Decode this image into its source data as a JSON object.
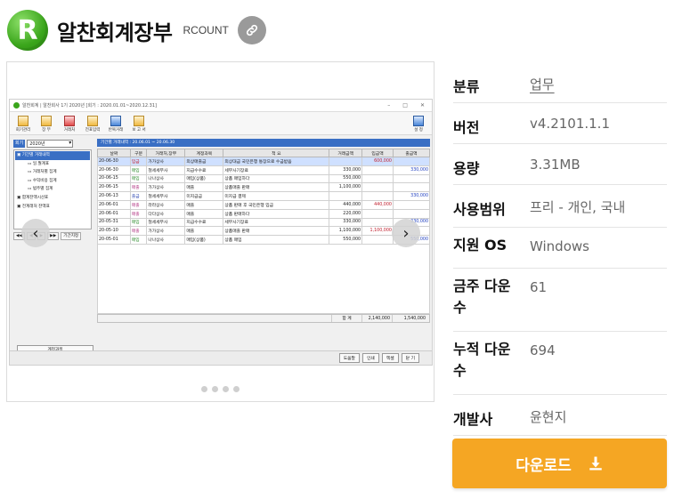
{
  "header": {
    "app_name": "알찬회계장부",
    "app_sub": "RCOUNT",
    "logo_letter": "R"
  },
  "screenshot": {
    "window_title": "알찬회계 | 알찬회사 1기 2020년 [회기 : 2020.01.01~2020.12.31]",
    "toolbar": [
      {
        "label": "회기관리",
        "icon": "folder-icon",
        "color": "gold"
      },
      {
        "label": "장 부",
        "icon": "book-icon",
        "color": "gold"
      },
      {
        "label": "거래처",
        "icon": "contacts-icon",
        "color": "red"
      },
      {
        "label": "전표입력",
        "icon": "voucher-icon",
        "color": "gold"
      },
      {
        "label": "반복거래",
        "icon": "repeat-icon",
        "color": "blue"
      },
      {
        "label": "보 고 서",
        "icon": "report-icon",
        "color": "gold"
      }
    ],
    "toolbar_right": {
      "label": "설 정",
      "icon": "settings-icon"
    },
    "year_label": "회기",
    "year_value": "2020년",
    "tree": [
      {
        "label": "기간별 거래내역",
        "level": "root"
      },
      {
        "label": "일.월계표",
        "level": "sub"
      },
      {
        "label": "거래처별 집계",
        "level": "sub"
      },
      {
        "label": "수익비용 집계",
        "level": "sub"
      },
      {
        "label": "범주별 집계",
        "level": "sub"
      },
      {
        "label": "합계잔액시산표",
        "level": "top"
      },
      {
        "label": "전계래처 잔액표",
        "level": "top"
      }
    ],
    "pager": [
      "◀◀",
      "◀",
      "▶",
      "▶▶",
      "기간지정"
    ],
    "side_buttons": [
      "계정과목",
      "초록마감",
      "전기이월"
    ],
    "period_text": "기간별 거래내역 : 20.06.01 ~ 20.06.30",
    "columns": [
      "날짜",
      "구분",
      "거래처,장부",
      "계정과목",
      "적 요",
      "거래금액",
      "입금액",
      "출금액"
    ],
    "rows": [
      {
        "date": "20-06-30",
        "type": "입금",
        "party": "가가상사",
        "account": "외상매출금",
        "memo": "외상대금 국민은행 통장으로 수금받음",
        "amount": "",
        "in": "600,000",
        "out": "",
        "t": "in",
        "sel": true
      },
      {
        "date": "20-06-30",
        "type": "매입",
        "party": "철세세무사",
        "account": "지급수수료",
        "memo": "세무사기장료",
        "amount": "330,000",
        "in": "",
        "out": "330,000",
        "t": "buy"
      },
      {
        "date": "20-06-15",
        "type": "매입",
        "party": "나나상사",
        "account": "매입(상품)",
        "memo": "상품 매입하다",
        "amount": "550,000",
        "in": "",
        "out": "",
        "t": "buy"
      },
      {
        "date": "20-06-15",
        "type": "매출",
        "party": "가가상사",
        "account": "매출",
        "memo": "상품매출 판매",
        "amount": "1,100,000",
        "in": "",
        "out": "",
        "t": "sell"
      },
      {
        "date": "20-06-13",
        "type": "출금",
        "party": "철세세무사",
        "account": "미지급금",
        "memo": "미지급 결제",
        "amount": "",
        "in": "",
        "out": "330,000",
        "t": "out"
      },
      {
        "date": "20-06-01",
        "type": "매출",
        "party": "라라상사",
        "account": "매출",
        "memo": "상품 판매 후 국민은행 입금",
        "amount": "440,000",
        "in": "440,000",
        "out": "",
        "t": "sell"
      },
      {
        "date": "20-06-01",
        "type": "매출",
        "party": "다다상사",
        "account": "매출",
        "memo": "상품 판매하다",
        "amount": "220,000",
        "in": "",
        "out": "",
        "t": "sell"
      },
      {
        "date": "20-05-31",
        "type": "매입",
        "party": "철세세무사",
        "account": "지급수수료",
        "memo": "세무사기장료",
        "amount": "330,000",
        "in": "",
        "out": "330,000",
        "t": "buy"
      },
      {
        "date": "20-05-10",
        "type": "매출",
        "party": "가가상사",
        "account": "매출",
        "memo": "상품매출 판매",
        "amount": "1,100,000",
        "in": "1,100,000",
        "out": "",
        "t": "sell"
      },
      {
        "date": "20-05-01",
        "type": "매입",
        "party": "나나상사",
        "account": "매입(상품)",
        "memo": "상품 매입",
        "amount": "550,000",
        "in": "",
        "out": "550,000",
        "t": "buy"
      }
    ],
    "total_label": "합 계",
    "total_in": "2,140,000",
    "total_out": "1,540,000",
    "bottom_buttons": [
      "도움말",
      "인쇄",
      "엑셀",
      "닫 기"
    ]
  },
  "carousel": {
    "dot_count": 4
  },
  "specs": [
    {
      "key": "분류",
      "value": "업무",
      "link": true
    },
    {
      "key": "버전",
      "value": "v4.2101.1.1"
    },
    {
      "key": "용량",
      "value": "3.31MB"
    },
    {
      "key": "사용범위",
      "value": "프리 - 개인, 국내"
    },
    {
      "key": "지원 OS",
      "value": "Windows"
    },
    {
      "key": "금주 다운수",
      "value": "61"
    },
    {
      "key": "누적 다운수",
      "value": "694"
    },
    {
      "key": "개발사",
      "value": "윤현지"
    }
  ],
  "download": {
    "label": "다운로드",
    "icon": "download-icon"
  },
  "colors": {
    "accent": "#f5a623",
    "brand_green": "#3aa51b",
    "selection_blue": "#3a6fc4"
  }
}
